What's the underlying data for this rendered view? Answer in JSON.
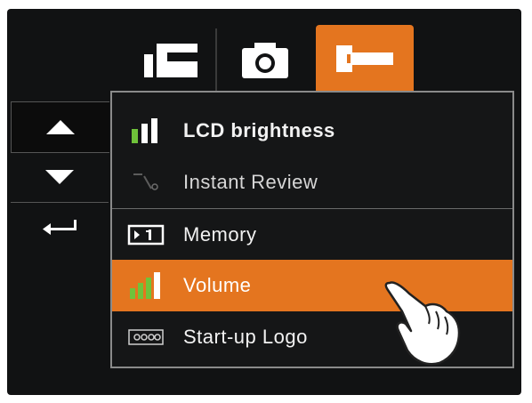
{
  "tabs": [
    {
      "id": "video",
      "icon": "video-mode-icon"
    },
    {
      "id": "photo",
      "icon": "camera-icon"
    },
    {
      "id": "setup",
      "icon": "wrench-icon",
      "active": true
    }
  ],
  "nav": [
    {
      "id": "up",
      "icon": "arrow-up-icon"
    },
    {
      "id": "down",
      "icon": "arrow-down-icon"
    },
    {
      "id": "enter",
      "icon": "enter-return-icon"
    }
  ],
  "menu": {
    "items": [
      {
        "label": "LCD brightness",
        "icon": "brightness-bars-icon"
      },
      {
        "label": "Instant Review",
        "icon": "review-1s-icon"
      },
      {
        "label": "Memory",
        "icon": "memory-card-icon"
      },
      {
        "label": "Volume",
        "icon": "volume-bars-icon",
        "selected": true
      },
      {
        "label": "Start-up Logo",
        "icon": "logo-icon"
      }
    ]
  },
  "colors": {
    "accent": "#e4751f",
    "background": "#111213",
    "bar_green": "#6fc23a"
  }
}
